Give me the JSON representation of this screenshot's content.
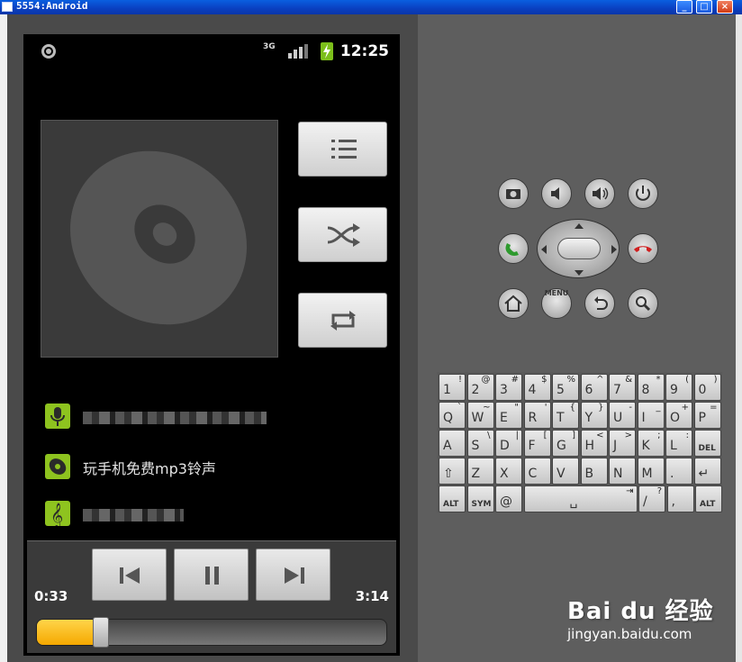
{
  "window": {
    "title": "5554:Android"
  },
  "window_buttons": {
    "minimize": "_",
    "maximize": "□",
    "close": "×"
  },
  "status": {
    "time": "12:25",
    "network": "3G"
  },
  "player": {
    "elapsed": "0:33",
    "duration": "3:14",
    "progress": 0.17
  },
  "list": {
    "album_title": "玩手机免费mp3铃声"
  },
  "accent_colors": {
    "list_icon": "#8ec31f",
    "seek_fill": "#f5a800",
    "call_green": "#2e9a2e",
    "end_red": "#d02020"
  },
  "hardware_buttons": {
    "menu_label": "MENU"
  },
  "keyboard": {
    "row1": [
      {
        "main": "1",
        "sub": "!"
      },
      {
        "main": "2",
        "sub": "@"
      },
      {
        "main": "3",
        "sub": "#"
      },
      {
        "main": "4",
        "sub": "$"
      },
      {
        "main": "5",
        "sub": "%"
      },
      {
        "main": "6",
        "sub": "^"
      },
      {
        "main": "7",
        "sub": "&"
      },
      {
        "main": "8",
        "sub": "*"
      },
      {
        "main": "9",
        "sub": "("
      },
      {
        "main": "0",
        "sub": ")"
      }
    ],
    "row2": [
      {
        "main": "Q",
        "sub": "`"
      },
      {
        "main": "W",
        "sub": "~"
      },
      {
        "main": "E",
        "sub": "\""
      },
      {
        "main": "R",
        "sub": "'"
      },
      {
        "main": "T",
        "sub": "{"
      },
      {
        "main": "Y",
        "sub": "}"
      },
      {
        "main": "U",
        "sub": "-"
      },
      {
        "main": "I",
        "sub": "_"
      },
      {
        "main": "O",
        "sub": "+"
      },
      {
        "main": "P",
        "sub": "="
      }
    ],
    "row3": [
      {
        "main": "A",
        "sub": ""
      },
      {
        "main": "S",
        "sub": "\\"
      },
      {
        "main": "D",
        "sub": "|"
      },
      {
        "main": "F",
        "sub": "["
      },
      {
        "main": "G",
        "sub": "]"
      },
      {
        "main": "H",
        "sub": "<"
      },
      {
        "main": "J",
        "sub": ">"
      },
      {
        "main": "K",
        "sub": ";"
      },
      {
        "main": "L",
        "sub": ":"
      },
      {
        "main": "DEL",
        "sub": ""
      }
    ],
    "row4": [
      {
        "main": "⇧",
        "sub": ""
      },
      {
        "main": "Z",
        "sub": ""
      },
      {
        "main": "X",
        "sub": ""
      },
      {
        "main": "C",
        "sub": ""
      },
      {
        "main": "V",
        "sub": ""
      },
      {
        "main": "B",
        "sub": ""
      },
      {
        "main": "N",
        "sub": ""
      },
      {
        "main": "M",
        "sub": ""
      },
      {
        "main": ".",
        "sub": ""
      },
      {
        "main": "↵",
        "sub": ""
      }
    ],
    "row5": {
      "alt_left": "ALT",
      "sym": "SYM",
      "at": "@",
      "space": "␣",
      "tab": "⇥",
      "slash": "/",
      "slash_sub": "?",
      "comma": ",",
      "alt_right": "ALT"
    }
  },
  "watermark": {
    "logo": "Bai du 经验",
    "url": "jingyan.baidu.com"
  }
}
